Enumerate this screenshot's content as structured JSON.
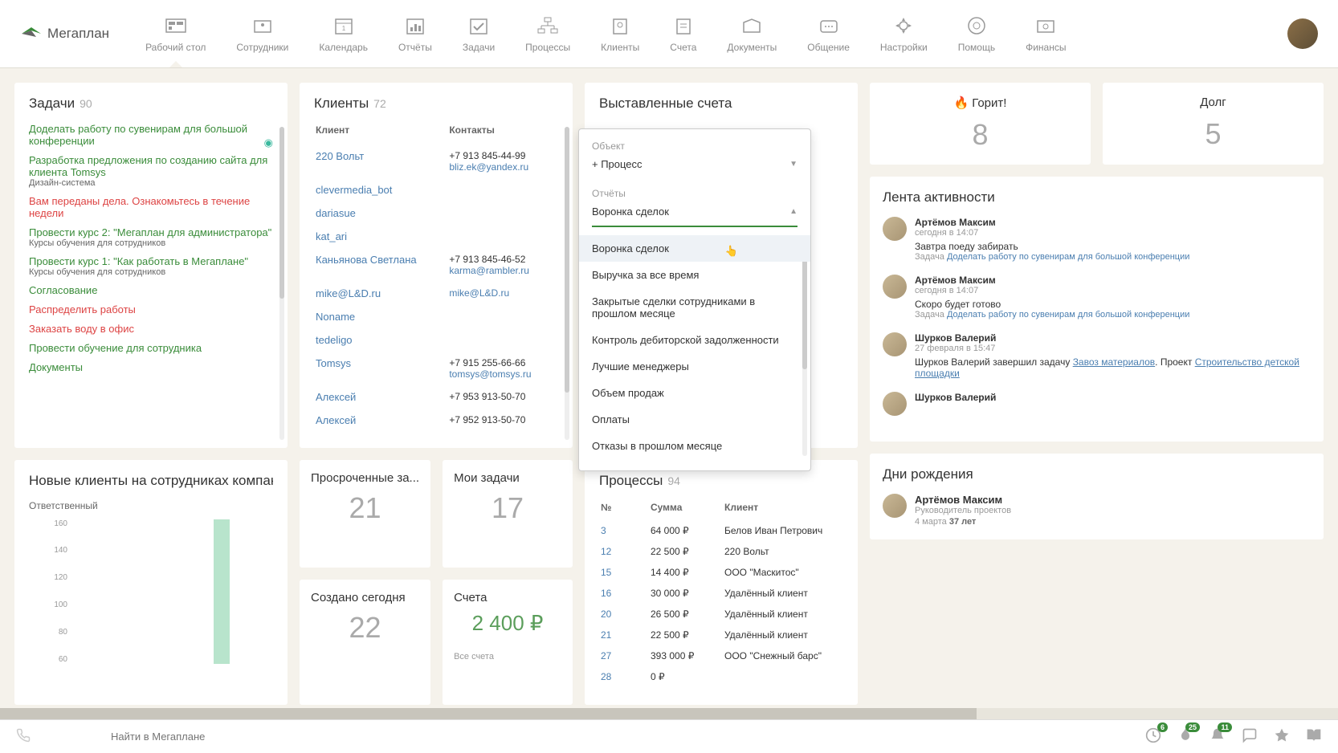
{
  "app": {
    "name": "Мегаплан"
  },
  "nav": {
    "items": [
      {
        "label": "Рабочий стол"
      },
      {
        "label": "Сотрудники"
      },
      {
        "label": "Календарь"
      },
      {
        "label": "Отчёты"
      },
      {
        "label": "Задачи"
      },
      {
        "label": "Процессы"
      },
      {
        "label": "Клиенты"
      },
      {
        "label": "Счета"
      },
      {
        "label": "Документы"
      },
      {
        "label": "Общение"
      },
      {
        "label": "Настройки"
      },
      {
        "label": "Помощь"
      },
      {
        "label": "Финансы"
      }
    ]
  },
  "tasks": {
    "title": "Задачи",
    "count": "90",
    "items": [
      {
        "text": "Доделать работу по сувенирам для большой конференции",
        "cls": "task-green",
        "badge": true
      },
      {
        "text": "Разработка предложения по созданию сайта для клиента Tomsys",
        "cls": "task-green",
        "sub": "Дизайн-система"
      },
      {
        "text": "Вам переданы дела. Ознакомьтесь в течение недели",
        "cls": "task-red"
      },
      {
        "text": "Провести курс 2: \"Мегаплан для администратора\"",
        "cls": "task-green",
        "sub": "Курсы обучения для сотрудников"
      },
      {
        "text": "Провести курс 1: \"Как работать в Мегаплане\"",
        "cls": "task-green",
        "sub": "Курсы обучения для сотрудников"
      },
      {
        "text": "Согласование",
        "cls": "task-green"
      },
      {
        "text": "Распределить работы",
        "cls": "task-red"
      },
      {
        "text": "Заказать воду в офис",
        "cls": "task-red"
      },
      {
        "text": "Провести обучение для сотрудника",
        "cls": "task-green"
      },
      {
        "text": "Документы",
        "cls": "task-green"
      }
    ]
  },
  "clients": {
    "title": "Клиенты",
    "count": "72",
    "cols": {
      "name": "Клиент",
      "contact": "Контакты"
    },
    "rows": [
      {
        "name": "220 Вольт",
        "phone": "+7 913 845-44-99",
        "email": "bliz.ek@yandex.ru"
      },
      {
        "name": "clevermedia_bot"
      },
      {
        "name": "dariasue"
      },
      {
        "name": "kat_ari"
      },
      {
        "name": "Каньянова Светлана",
        "phone": "+7 913 845-46-52",
        "email": "karma@rambler.ru"
      },
      {
        "name": "mike@L&D.ru",
        "contact_plain": "mike@L&D.ru",
        "email_as_contact": true
      },
      {
        "name": "Noname"
      },
      {
        "name": "tedeligo"
      },
      {
        "name": "Tomsys",
        "phone": "+7 915 255-66-66",
        "email": "tomsys@tomsys.ru"
      },
      {
        "name": "Алексей",
        "phone": "+7 953 913-50-70"
      },
      {
        "name": "Алексей",
        "phone": "+7 952 913-50-70"
      }
    ]
  },
  "invoices": {
    "title": "Выставленные счета"
  },
  "dropdown": {
    "object_label": "Объект",
    "object_value": "+ Процесс",
    "reports_label": "Отчёты",
    "reports_value": "Воронка сделок",
    "options": [
      "Воронка сделок",
      "Выручка за все время",
      "Закрытые сделки сотрудниками в прошлом месяце",
      "Контроль дебиторской задолженности",
      "Лучшие менеджеры",
      "Объем продаж",
      "Оплаты",
      "Отказы в прошлом месяце"
    ]
  },
  "stats": {
    "hot": {
      "title": "Горит!",
      "value": "8"
    },
    "debt": {
      "title": "Долг",
      "value": "5"
    }
  },
  "activity": {
    "title": "Лента активности",
    "items": [
      {
        "name": "Артёмов Максим",
        "time": "сегодня в 14:07",
        "text": "Завтра поеду забирать",
        "task_prefix": "Задача",
        "task": "Доделать работу по сувенирам для большой конференции"
      },
      {
        "name": "Артёмов Максим",
        "time": "сегодня в 14:07",
        "text": "Скоро будет готово",
        "task_prefix": "Задача",
        "task": "Доделать работу по сувенирам для большой конференции"
      },
      {
        "name": "Шурков Валерий",
        "time": "27 февраля в 15:47",
        "rich_prefix": "Шурков Валерий завершил задачу",
        "rich_link1": "Завоз материалов",
        "rich_mid": ". Проект",
        "rich_link2": "Строительство детской площадки"
      },
      {
        "name": "Шурков Валерий",
        "time": ""
      }
    ]
  },
  "birthdays": {
    "title": "Дни рождения",
    "items": [
      {
        "name": "Артёмов Максим",
        "role": "Руководитель проектов",
        "date": "4 марта",
        "age": "37 лет"
      }
    ]
  },
  "new_clients": {
    "title": "Новые клиенты на сотрудниках компани...",
    "subtitle": "Ответственный",
    "y_ticks": [
      "160",
      "140",
      "120",
      "100",
      "80",
      "60"
    ]
  },
  "chart_data": {
    "type": "bar",
    "title": "Новые клиенты на сотрудниках компании",
    "xlabel": "Ответственный",
    "y_ticks": [
      60,
      80,
      100,
      120,
      140,
      160
    ],
    "categories": [
      ""
    ],
    "values": [
      160
    ],
    "ylim": [
      0,
      170
    ]
  },
  "small_cards": {
    "overdue": {
      "title": "Просроченные за...",
      "value": "21"
    },
    "mytasks": {
      "title": "Мои задачи",
      "value": "17"
    },
    "created": {
      "title": "Создано сегодня",
      "value": "22"
    },
    "accounts": {
      "title": "Счета",
      "value": "2 400 ₽",
      "sub": "Все счета"
    }
  },
  "processes": {
    "title": "Процессы",
    "count": "94",
    "cols": {
      "num": "№",
      "sum": "Сумма",
      "client": "Клиент"
    },
    "rows": [
      {
        "num": "3",
        "sum": "64 000 ₽",
        "client": "Белов Иван Петрович"
      },
      {
        "num": "12",
        "sum": "22 500 ₽",
        "client": "220 Вольт"
      },
      {
        "num": "15",
        "sum": "14 400 ₽",
        "client": "ООО \"Маскитос\""
      },
      {
        "num": "16",
        "sum": "30 000 ₽",
        "client": "Удалённый клиент"
      },
      {
        "num": "20",
        "sum": "26 500 ₽",
        "client": "Удалённый клиент"
      },
      {
        "num": "21",
        "sum": "22 500 ₽",
        "client": "Удалённый клиент"
      },
      {
        "num": "27",
        "sum": "393 000 ₽",
        "client": "ООО \"Снежный барс\""
      },
      {
        "num": "28",
        "sum": "0 ₽",
        "client": ""
      }
    ]
  },
  "bottom": {
    "search_placeholder": "Найти в Мегаплане",
    "badges": {
      "clock": "6",
      "fire": "25",
      "bell": "11"
    }
  }
}
